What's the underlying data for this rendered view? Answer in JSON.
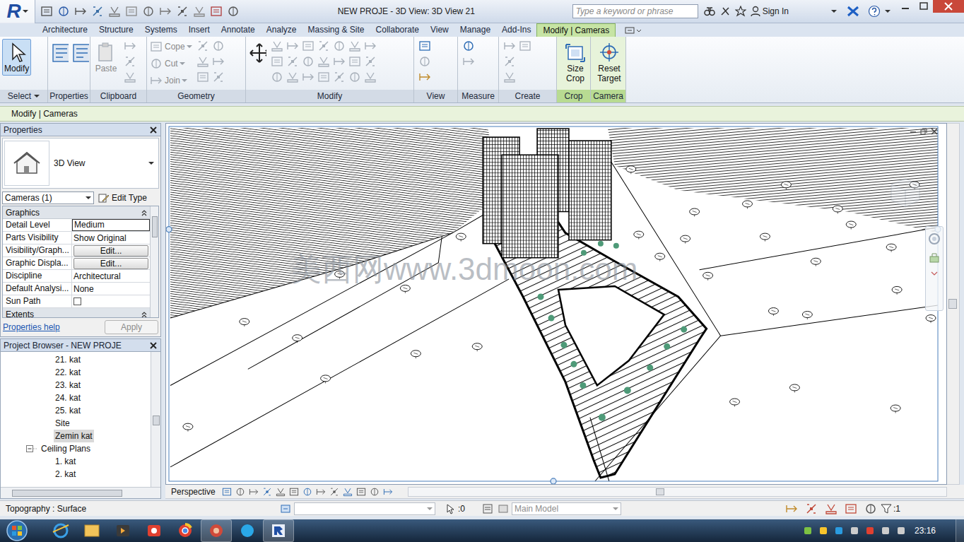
{
  "window": {
    "logo": "R",
    "title": "NEW PROJE - 3D View: 3D View 21",
    "search_placeholder": "Type a keyword or phrase",
    "sign_in": "Sign In"
  },
  "ribbon_tabs": [
    {
      "label": "Architecture",
      "selected": false
    },
    {
      "label": "Structure",
      "selected": false
    },
    {
      "label": "Systems",
      "selected": false
    },
    {
      "label": "Insert",
      "selected": false
    },
    {
      "label": "Annotate",
      "selected": false
    },
    {
      "label": "Analyze",
      "selected": false
    },
    {
      "label": "Massing & Site",
      "selected": false
    },
    {
      "label": "Collaborate",
      "selected": false
    },
    {
      "label": "View",
      "selected": false
    },
    {
      "label": "Manage",
      "selected": false
    },
    {
      "label": "Add-Ins",
      "selected": false
    },
    {
      "label": "Modify | Cameras",
      "selected": true
    }
  ],
  "ribbon_panels": [
    {
      "label": "Select",
      "contextual": false,
      "has_menu": true,
      "buttons": [
        {
          "label": "Modify",
          "kind": "large",
          "selected": true,
          "disabled": false
        }
      ]
    },
    {
      "label": "Properties",
      "contextual": false,
      "has_menu": false,
      "buttons": []
    },
    {
      "label": "Clipboard",
      "contextual": false,
      "has_menu": false,
      "buttons": [
        {
          "label": "Paste",
          "kind": "large",
          "selected": false,
          "disabled": true
        }
      ]
    },
    {
      "label": "Geometry",
      "contextual": false,
      "has_menu": false,
      "buttons": [
        {
          "label": "Cope",
          "kind": "small",
          "selected": false,
          "disabled": true
        },
        {
          "label": "Cut",
          "kind": "small",
          "selected": false,
          "disabled": true
        },
        {
          "label": "Join",
          "kind": "small",
          "selected": false,
          "disabled": true
        }
      ]
    },
    {
      "label": "Modify",
      "contextual": false,
      "has_menu": false,
      "buttons": []
    },
    {
      "label": "View",
      "contextual": false,
      "has_menu": false,
      "buttons": []
    },
    {
      "label": "Measure",
      "contextual": false,
      "has_menu": false,
      "buttons": []
    },
    {
      "label": "Create",
      "contextual": false,
      "has_menu": false,
      "buttons": []
    },
    {
      "label": "Crop",
      "contextual": true,
      "has_menu": false,
      "buttons": [
        {
          "label": "Size Crop",
          "kind": "large",
          "selected": false,
          "disabled": false
        }
      ]
    },
    {
      "label": "Camera",
      "contextual": true,
      "has_menu": false,
      "buttons": [
        {
          "label": "Reset Target",
          "kind": "large",
          "selected": false,
          "disabled": false
        }
      ]
    }
  ],
  "options_bar": {
    "label": "Modify | Cameras"
  },
  "properties": {
    "title": "Properties",
    "type_name": "3D View",
    "instance_filter": "Cameras (1)",
    "edit_type": "Edit Type",
    "group": "Graphics",
    "rows": [
      {
        "label": "Detail Level",
        "value": "Medium",
        "kind": "field"
      },
      {
        "label": "Parts Visibility",
        "value": "Show Original",
        "kind": "text"
      },
      {
        "label": "Visibility/Graph...",
        "value": "Edit...",
        "kind": "button"
      },
      {
        "label": "Graphic Displa...",
        "value": "Edit...",
        "kind": "button"
      },
      {
        "label": "Discipline",
        "value": "Architectural",
        "kind": "text"
      },
      {
        "label": "Default Analysi...",
        "value": "None",
        "kind": "text"
      },
      {
        "label": "Sun Path",
        "value": "",
        "kind": "checkbox",
        "checked": false
      }
    ],
    "next_group": "Extents",
    "help": "Properties help",
    "apply": {
      "label": "Apply",
      "disabled": true
    }
  },
  "project_browser": {
    "title": "Project Browser - NEW PROJE",
    "items": [
      {
        "label": "21. kat",
        "depth": 2,
        "kind": "leaf",
        "expanded": false,
        "selected": false
      },
      {
        "label": "22. kat",
        "depth": 2,
        "kind": "leaf",
        "expanded": false,
        "selected": false
      },
      {
        "label": "23. kat",
        "depth": 2,
        "kind": "leaf",
        "expanded": false,
        "selected": false
      },
      {
        "label": "24. kat",
        "depth": 2,
        "kind": "leaf",
        "expanded": false,
        "selected": false
      },
      {
        "label": "25. kat",
        "depth": 2,
        "kind": "leaf",
        "expanded": false,
        "selected": false
      },
      {
        "label": "Site",
        "depth": 2,
        "kind": "leaf",
        "expanded": false,
        "selected": false
      },
      {
        "label": "Zemin kat",
        "depth": 2,
        "kind": "leaf",
        "expanded": false,
        "selected": true
      },
      {
        "label": "Ceiling Plans",
        "depth": 1,
        "kind": "group",
        "expanded": true,
        "selected": false
      },
      {
        "label": "1. kat",
        "depth": 2,
        "kind": "leaf",
        "expanded": false,
        "selected": false
      },
      {
        "label": "2. kat",
        "depth": 2,
        "kind": "leaf",
        "expanded": false,
        "selected": false
      }
    ]
  },
  "viewport": {
    "watermark": "美西网www.3dmoon.com"
  },
  "view_bar": {
    "mode": "Perspective"
  },
  "status_bar": {
    "message": "Topography : Surface",
    "selection_count": ":0",
    "model": {
      "label": "Main Model",
      "disabled": true
    },
    "filter_count": ":1"
  },
  "taskbar": {
    "time": "23:16"
  }
}
